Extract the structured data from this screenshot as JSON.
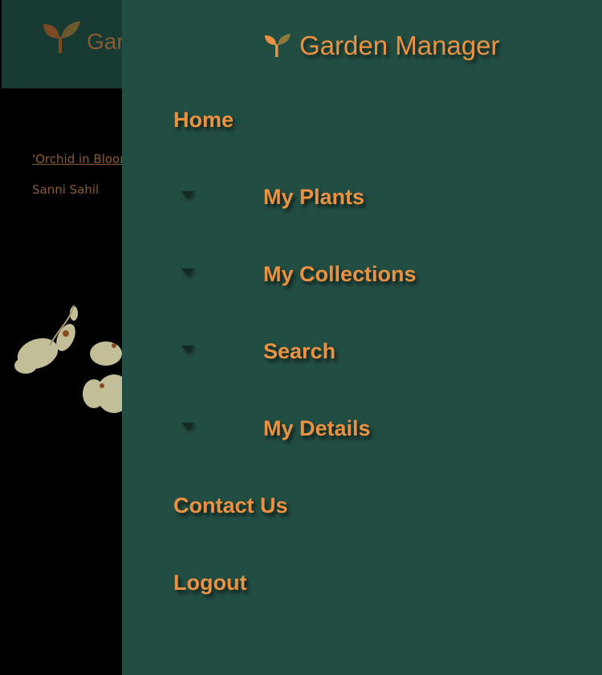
{
  "app": {
    "title": "Garden Manager"
  },
  "background": {
    "header_title": "Garden Manager",
    "item_link": "'Orchid in Bloom",
    "item_author": "Sanni Sahil"
  },
  "drawer": {
    "title": "Garden Manager",
    "nav": {
      "home": "Home",
      "my_plants": "My Plants",
      "my_collections": "My Collections",
      "search": "Search",
      "my_details": "My Details",
      "contact_us": "Contact Us",
      "logout": "Logout"
    }
  },
  "colors": {
    "accent": "#ea9142",
    "drawer_bg": "#224d42",
    "header_bg": "#173a33"
  }
}
